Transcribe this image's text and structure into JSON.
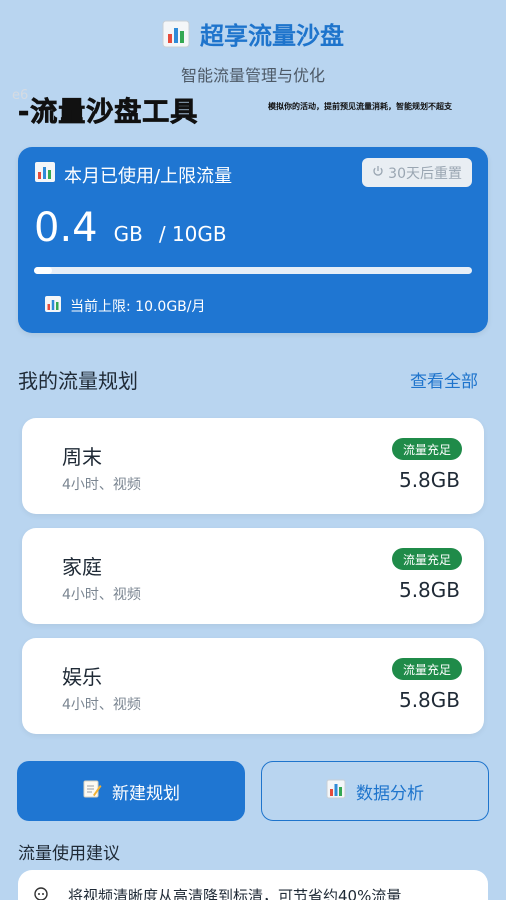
{
  "header": {
    "title": "超享流量沙盘",
    "subtitle": "智能流量管理与优化",
    "watermark_id": "e6",
    "banner_big": "-流量沙盘工具",
    "banner_small": "模拟你的活动，提前预见流量消耗，智能规划不超支"
  },
  "usage": {
    "title": "本月已使用/上限流量",
    "reset_label": "30天后重置",
    "used_value": "0.4",
    "used_unit": "GB",
    "limit_text": "/ 10GB",
    "progress_fraction": 0.04,
    "limit_line": "当前上限: 10.0GB/月"
  },
  "plans_section": {
    "title": "我的流量规划",
    "view_all": "查看全部",
    "items": [
      {
        "name": "周末",
        "desc": "4小时、视频",
        "status": "流量充足",
        "amount": "5.8GB"
      },
      {
        "name": "家庭",
        "desc": "4小时、视频",
        "status": "流量充足",
        "amount": "5.8GB"
      },
      {
        "name": "娱乐",
        "desc": "4小时、视频",
        "status": "流量充足",
        "amount": "5.8GB"
      }
    ]
  },
  "actions": {
    "new_plan": "新建规划",
    "analysis": "数据分析"
  },
  "tips": {
    "title": "流量使用建议",
    "items": [
      "将视频清晰度从高清降到标清，可节省约40%流量"
    ]
  },
  "colors": {
    "accent": "#1f76d2",
    "background": "#b9d5f0",
    "status_green": "#1f8b49"
  }
}
